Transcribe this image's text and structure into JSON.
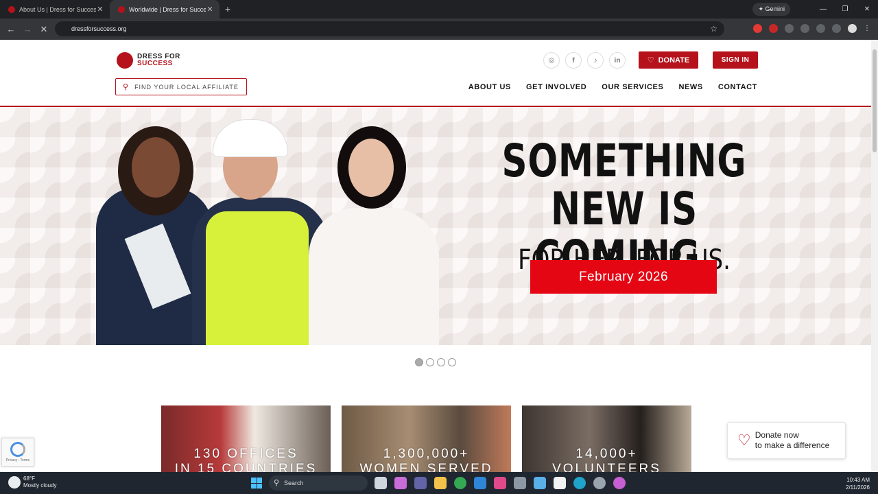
{
  "browser": {
    "tabs": [
      {
        "title": "About Us | Dress for Success"
      },
      {
        "title": "Worldwide | Dress for Success"
      }
    ],
    "gemini_label": "Gemini",
    "url": "dressforsuccess.org"
  },
  "site": {
    "logo_line1": "DRESS FOR",
    "logo_line2": "SUCCESS",
    "affiliate_search": "FIND YOUR LOCAL AFFILIATE",
    "social": [
      "instagram-icon",
      "facebook-icon",
      "tiktok-icon",
      "linkedin-icon"
    ],
    "donate_label": "DONATE",
    "signin_label": "SIGN IN",
    "nav": [
      "ABOUT US",
      "GET INVOLVED",
      "OUR SERVICES",
      "NEWS",
      "CONTACT"
    ],
    "hero": {
      "title": "SOMETHING NEW IS COMING.",
      "subtitle": "FOR HER. FOR US.",
      "date": "February 2026"
    },
    "slides": 4,
    "active_slide": 1,
    "stats": [
      {
        "line1": "130 OFFICES",
        "line2": "IN 15 COUNTRIES"
      },
      {
        "line1": "1,300,000+",
        "line2": "WOMEN SERVED"
      },
      {
        "line1": "14,000+",
        "line2": "VOLUNTEERS"
      }
    ],
    "recaptcha_text": "Privacy - Terms",
    "donate_float": {
      "line1": "Donate now",
      "line2": "to make a difference"
    }
  },
  "taskbar": {
    "temp": "68°F",
    "weather": "Mostly cloudy",
    "search": "Search",
    "time": "10:43 AM",
    "date": "2/11/2026"
  },
  "colors": {
    "brand": "#b5121b",
    "hero_button": "#e40613"
  }
}
